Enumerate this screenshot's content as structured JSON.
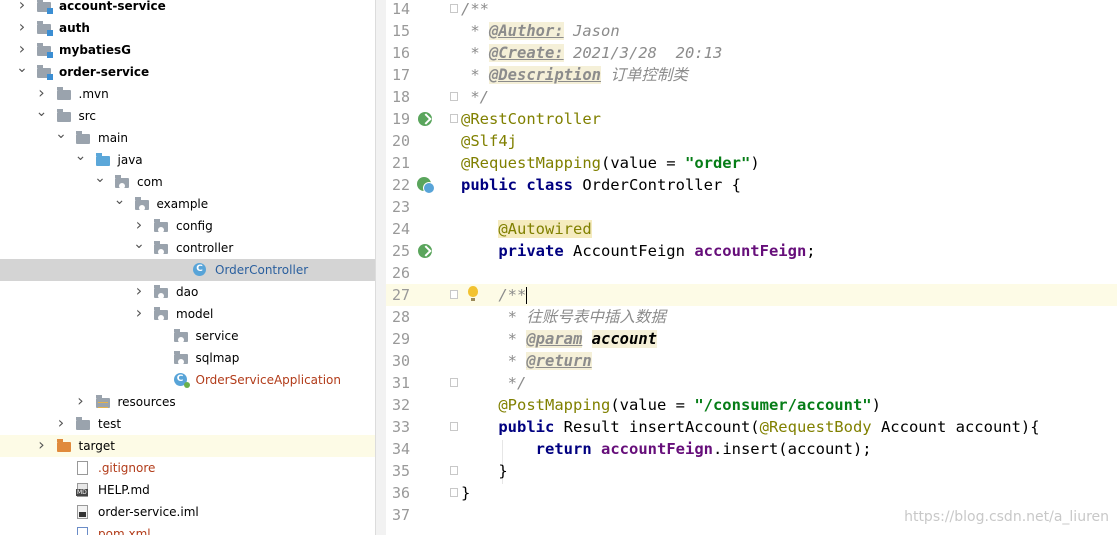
{
  "tree": [
    {
      "label": "account-service",
      "bold": true,
      "arrow": "›",
      "indent": 0,
      "icon": "module-folder"
    },
    {
      "label": "auth",
      "bold": true,
      "arrow": "›",
      "indent": 0,
      "icon": "module-folder"
    },
    {
      "label": "mybatiesG",
      "bold": true,
      "arrow": "›",
      "indent": 0,
      "icon": "module-folder"
    },
    {
      "label": "order-service",
      "bold": true,
      "arrow": "⌄",
      "indent": 0,
      "icon": "module-folder"
    },
    {
      "label": ".mvn",
      "arrow": "›",
      "indent": 1,
      "icon": "folder"
    },
    {
      "label": "src",
      "arrow": "⌄",
      "indent": 1,
      "icon": "folder"
    },
    {
      "label": "main",
      "arrow": "⌄",
      "indent": 2,
      "icon": "folder"
    },
    {
      "label": "java",
      "arrow": "⌄",
      "indent": 3,
      "icon": "source-folder"
    },
    {
      "label": "com",
      "arrow": "⌄",
      "indent": 4,
      "icon": "package"
    },
    {
      "label": "example",
      "arrow": "⌄",
      "indent": 5,
      "icon": "package"
    },
    {
      "label": "config",
      "arrow": "›",
      "indent": 6,
      "icon": "package"
    },
    {
      "label": "controller",
      "arrow": "⌄",
      "indent": 6,
      "icon": "package"
    },
    {
      "label": "OrderController",
      "arrow": "",
      "indent": 8,
      "icon": "class",
      "selected": true,
      "color": "blue"
    },
    {
      "label": "dao",
      "arrow": "›",
      "indent": 6,
      "icon": "package"
    },
    {
      "label": "model",
      "arrow": "›",
      "indent": 6,
      "icon": "package"
    },
    {
      "label": "service",
      "arrow": "",
      "indent": 7,
      "icon": "package"
    },
    {
      "label": "sqlmap",
      "arrow": "",
      "indent": 7,
      "icon": "package"
    },
    {
      "label": "OrderServiceApplication",
      "arrow": "",
      "indent": 7,
      "icon": "app-class",
      "color": "red"
    },
    {
      "label": "resources",
      "arrow": "›",
      "indent": 3,
      "icon": "resources-folder"
    },
    {
      "label": "test",
      "arrow": "›",
      "indent": 2,
      "icon": "folder"
    },
    {
      "label": "target",
      "arrow": "›",
      "indent": 1,
      "icon": "excluded-folder",
      "highlight": true
    },
    {
      "label": ".gitignore",
      "arrow": "",
      "indent": 2,
      "icon": "text-file",
      "color": "red"
    },
    {
      "label": "HELP.md",
      "arrow": "",
      "indent": 2,
      "icon": "markdown-file"
    },
    {
      "label": "order-service.iml",
      "arrow": "",
      "indent": 2,
      "icon": "iml-file"
    },
    {
      "label": "pom.xml",
      "arrow": "",
      "indent": 2,
      "icon": "maven-file",
      "color": "red"
    }
  ],
  "editor": {
    "lines": [
      {
        "n": "14",
        "html": "<span class='cm'>/**</span>",
        "fold": true
      },
      {
        "n": "15",
        "html": "<span class='cm'> * </span><span class='tagc'>@Author:</span><span class='cm'> Jason</span>"
      },
      {
        "n": "16",
        "html": "<span class='cm'> * </span><span class='tagc'>@Create:</span><span class='cm'> 2021/3/28  20:13</span>"
      },
      {
        "n": "17",
        "html": "<span class='cm'> * </span><span class='tagc'>@Description</span><span class='cm'> 订单控制类</span>"
      },
      {
        "n": "18",
        "html": "<span class='cm'> */</span>",
        "fold": true
      },
      {
        "n": "19",
        "html": "<span class='ann'>@RestController</span>",
        "fold": true,
        "gutter": "run-icon"
      },
      {
        "n": "20",
        "html": "<span class='ann'>@Slf4j</span>"
      },
      {
        "n": "21",
        "html": "<span class='ann'>@RequestMapping</span>(value = <span class='str'>\"order\"</span>)"
      },
      {
        "n": "22",
        "html": "<span class='kw'>public class</span> OrderController {",
        "gutter": "class-icon"
      },
      {
        "n": "23",
        "html": ""
      },
      {
        "n": "24",
        "html": "    <span class='annbg'>@Autowired</span>"
      },
      {
        "n": "25",
        "html": "    <span class='kw'>private</span> AccountFeign <span class='fld'>accountFeign</span>;",
        "gutter": "bean-icon"
      },
      {
        "n": "26",
        "html": ""
      },
      {
        "n": "27",
        "html": "    <span class='cm'>/**</span><span class='caret'></span>",
        "fold": true,
        "current": true,
        "bulb": true
      },
      {
        "n": "28",
        "html": "<span class='cm'>     * 往账号表中插入数据</span>"
      },
      {
        "n": "29",
        "html": "<span class='cm'>     * </span><span class='tagc'>@param</span><span class='cm'> </span><span class='pname'>account</span>"
      },
      {
        "n": "30",
        "html": "<span class='cm'>     * </span><span class='tagc'>@return</span>"
      },
      {
        "n": "31",
        "html": "<span class='cm'>     */</span>",
        "fold": true
      },
      {
        "n": "32",
        "html": "    <span class='ann'>@PostMapping</span>(value = <span class='str'>\"/consumer/account\"</span>)"
      },
      {
        "n": "33",
        "html": "    <span class='kw'>public</span> Result insertAccount(<span class='ann'>@RequestBody</span> Account account){",
        "fold": true
      },
      {
        "n": "34",
        "html": "        <span class='kw'>return</span> <span class='fld'>accountFeign</span>.insert(account);"
      },
      {
        "n": "35",
        "html": "    }",
        "fold": true
      },
      {
        "n": "36",
        "html": "}",
        "fold": true
      },
      {
        "n": "37",
        "html": ""
      }
    ]
  },
  "watermark": "https://blog.csdn.net/a_liuren"
}
